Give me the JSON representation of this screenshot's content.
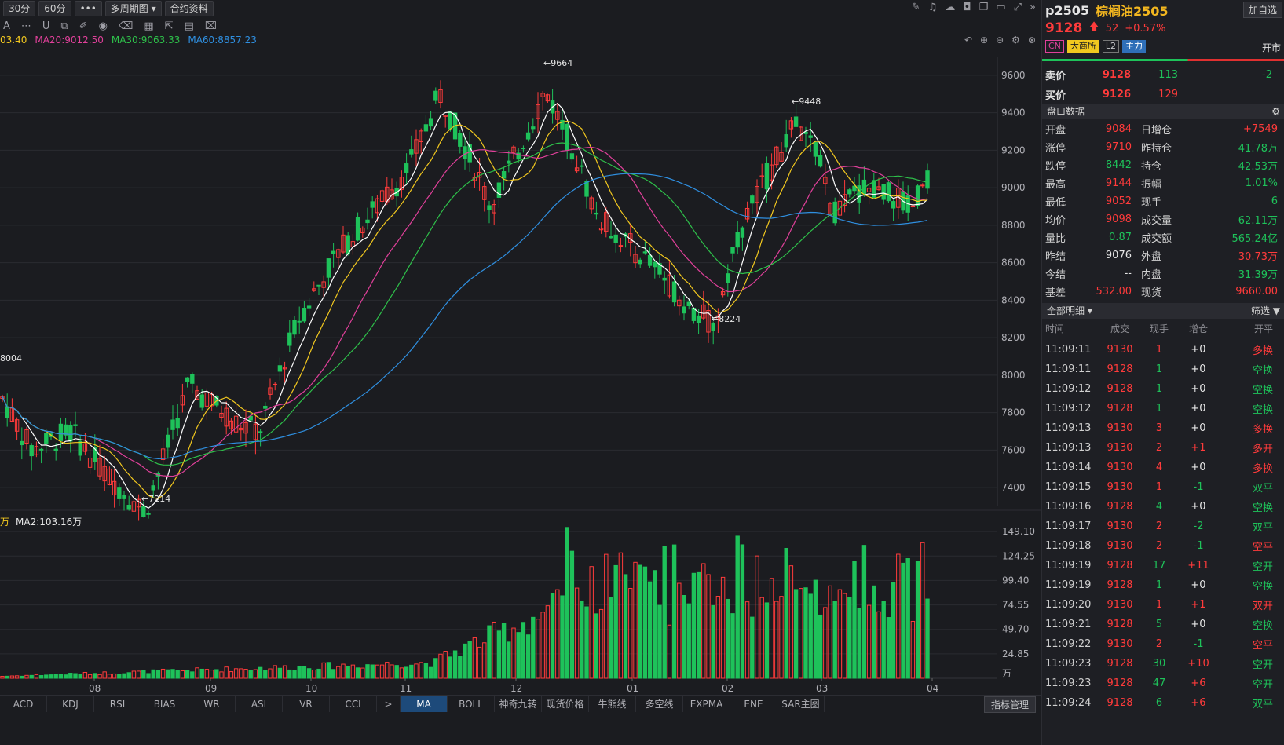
{
  "toolbar": {
    "btn_30": "30分",
    "btn_60": "60分",
    "btn_more": "•••",
    "btn_multi": "多周期图",
    "btn_contract": "合约资料"
  },
  "ma_legend": {
    "ma10": "03.40",
    "ma20": "MA20:9012.50",
    "ma30": "MA30:9063.33",
    "ma60": "MA60:8857.23"
  },
  "vol_legend": {
    "unit": "万",
    "ma2": "MA2:103.16万"
  },
  "chart_data": {
    "type": "candlestick",
    "price_axis": [
      "9600",
      "9400",
      "9200",
      "9000",
      "8800",
      "8600",
      "8400",
      "8200",
      "8000",
      "7800",
      "7600",
      "7400"
    ],
    "ylim": [
      7300,
      9700
    ],
    "x_ticks": [
      "08",
      "09",
      "10",
      "11",
      "12",
      "01",
      "02",
      "03",
      "04"
    ],
    "annotations": [
      "←9664",
      "←9448",
      "←8224",
      "←7214",
      "8004"
    ],
    "volume_axis": [
      "149.10",
      "124.25",
      "99.40",
      "74.55",
      "49.70",
      "24.85",
      "万"
    ],
    "volume_ylim": [
      0,
      150
    ],
    "ma_colors": {
      "ma5": "#ffffff",
      "ma10": "#f2c81f",
      "ma20": "#e0409a",
      "ma30": "#2ec04a",
      "ma60": "#2f8fe0"
    },
    "up_color": "#ff3b3b",
    "down_color": "#1ec25a"
  },
  "bottom_tabs": [
    "ACD",
    "KDJ",
    "RSI",
    "BIAS",
    "WR",
    "ASI",
    "VR",
    "CCI",
    ">",
    "MA",
    "BOLL",
    "神奇九转",
    "现货价格",
    "牛熊线",
    "多空线",
    "EXPMA",
    "ENE",
    "SAR主图"
  ],
  "manage": "指标管理",
  "quote": {
    "symbol": "p2505",
    "name": "棕榈油2505",
    "add": "加自选",
    "price": "9128",
    "arrow": "🡅",
    "change": "52",
    "pct": "+0.57%",
    "tags": [
      "CN",
      "大商所",
      "L2",
      "主力"
    ],
    "status": "开市",
    "ask_label": "卖价",
    "ask_price": "9128",
    "ask_vol": "113",
    "ask_delta": "-2",
    "bid_label": "买价",
    "bid_price": "9126",
    "bid_vol": "129",
    "panel_title": "盘口数据",
    "stats": [
      {
        "k1": "开盘",
        "v1": "9084",
        "c1": "red",
        "k2": "日增仓",
        "v2": "+7549",
        "c2": "red"
      },
      {
        "k1": "涨停",
        "v1": "9710",
        "c1": "red",
        "k2": "昨持仓",
        "v2": "41.78万",
        "c2": "green"
      },
      {
        "k1": "跌停",
        "v1": "8442",
        "c1": "green",
        "k2": "持仓",
        "v2": "42.53万",
        "c2": "green"
      },
      {
        "k1": "最高",
        "v1": "9144",
        "c1": "red",
        "k2": "振幅",
        "v2": "1.01%",
        "c2": "green"
      },
      {
        "k1": "最低",
        "v1": "9052",
        "c1": "red",
        "k2": "现手",
        "v2": "6",
        "c2": "green"
      },
      {
        "k1": "均价",
        "v1": "9098",
        "c1": "red",
        "k2": "成交量",
        "v2": "62.11万",
        "c2": "green"
      },
      {
        "k1": "量比",
        "v1": "0.87",
        "c1": "green",
        "k2": "成交额",
        "v2": "565.24亿",
        "c2": "green"
      },
      {
        "k1": "昨结",
        "v1": "9076",
        "c1": "white",
        "k2": "外盘",
        "v2": "30.73万",
        "c2": "red"
      },
      {
        "k1": "今结",
        "v1": "--",
        "c1": "white",
        "k2": "内盘",
        "v2": "31.39万",
        "c2": "green"
      },
      {
        "k1": "基差",
        "v1": "532.00",
        "c1": "red",
        "k2": "现货",
        "v2": "9660.00",
        "c2": "red"
      }
    ],
    "detail_title": "全部明细",
    "filter": "筛选",
    "trade_headers": [
      "时间",
      "成交",
      "现手",
      "增仓",
      "开平"
    ],
    "trades": [
      {
        "t": "11:09:11",
        "p": "9130",
        "v": "1",
        "oi": "+0",
        "ty": "多换",
        "pc": "red",
        "vc": "red",
        "oc": "white",
        "tc": "red"
      },
      {
        "t": "11:09:11",
        "p": "9128",
        "v": "1",
        "oi": "+0",
        "ty": "空换",
        "pc": "red",
        "vc": "green",
        "oc": "white",
        "tc": "green"
      },
      {
        "t": "11:09:12",
        "p": "9128",
        "v": "1",
        "oi": "+0",
        "ty": "空换",
        "pc": "red",
        "vc": "green",
        "oc": "white",
        "tc": "green"
      },
      {
        "t": "11:09:12",
        "p": "9128",
        "v": "1",
        "oi": "+0",
        "ty": "空换",
        "pc": "red",
        "vc": "green",
        "oc": "white",
        "tc": "green"
      },
      {
        "t": "11:09:13",
        "p": "9130",
        "v": "3",
        "oi": "+0",
        "ty": "多换",
        "pc": "red",
        "vc": "red",
        "oc": "white",
        "tc": "red"
      },
      {
        "t": "11:09:13",
        "p": "9130",
        "v": "2",
        "oi": "+1",
        "ty": "多开",
        "pc": "red",
        "vc": "red",
        "oc": "red",
        "tc": "red"
      },
      {
        "t": "11:09:14",
        "p": "9130",
        "v": "4",
        "oi": "+0",
        "ty": "多换",
        "pc": "red",
        "vc": "red",
        "oc": "white",
        "tc": "red"
      },
      {
        "t": "11:09:15",
        "p": "9130",
        "v": "1",
        "oi": "-1",
        "ty": "双平",
        "pc": "red",
        "vc": "red",
        "oc": "green",
        "tc": "green"
      },
      {
        "t": "11:09:16",
        "p": "9128",
        "v": "4",
        "oi": "+0",
        "ty": "空换",
        "pc": "red",
        "vc": "green",
        "oc": "white",
        "tc": "green"
      },
      {
        "t": "11:09:17",
        "p": "9130",
        "v": "2",
        "oi": "-2",
        "ty": "双平",
        "pc": "red",
        "vc": "red",
        "oc": "green",
        "tc": "green"
      },
      {
        "t": "11:09:18",
        "p": "9130",
        "v": "2",
        "oi": "-1",
        "ty": "空平",
        "pc": "red",
        "vc": "red",
        "oc": "green",
        "tc": "red"
      },
      {
        "t": "11:09:19",
        "p": "9128",
        "v": "17",
        "oi": "+11",
        "ty": "空开",
        "pc": "red",
        "vc": "green",
        "oc": "red",
        "tc": "green"
      },
      {
        "t": "11:09:19",
        "p": "9128",
        "v": "1",
        "oi": "+0",
        "ty": "空换",
        "pc": "red",
        "vc": "green",
        "oc": "white",
        "tc": "green"
      },
      {
        "t": "11:09:20",
        "p": "9130",
        "v": "1",
        "oi": "+1",
        "ty": "双开",
        "pc": "red",
        "vc": "red",
        "oc": "red",
        "tc": "red"
      },
      {
        "t": "11:09:21",
        "p": "9128",
        "v": "5",
        "oi": "+0",
        "ty": "空换",
        "pc": "red",
        "vc": "green",
        "oc": "white",
        "tc": "green"
      },
      {
        "t": "11:09:22",
        "p": "9130",
        "v": "2",
        "oi": "-1",
        "ty": "空平",
        "pc": "red",
        "vc": "red",
        "oc": "green",
        "tc": "red"
      },
      {
        "t": "11:09:23",
        "p": "9128",
        "v": "30",
        "oi": "+10",
        "ty": "空开",
        "pc": "red",
        "vc": "green",
        "oc": "red",
        "tc": "green"
      },
      {
        "t": "11:09:23",
        "p": "9128",
        "v": "47",
        "oi": "+6",
        "ty": "空开",
        "pc": "red",
        "vc": "green",
        "oc": "red",
        "tc": "green"
      },
      {
        "t": "11:09:24",
        "p": "9128",
        "v": "6",
        "oi": "+6",
        "ty": "双平",
        "pc": "red",
        "vc": "green",
        "oc": "red",
        "tc": "green"
      }
    ]
  }
}
